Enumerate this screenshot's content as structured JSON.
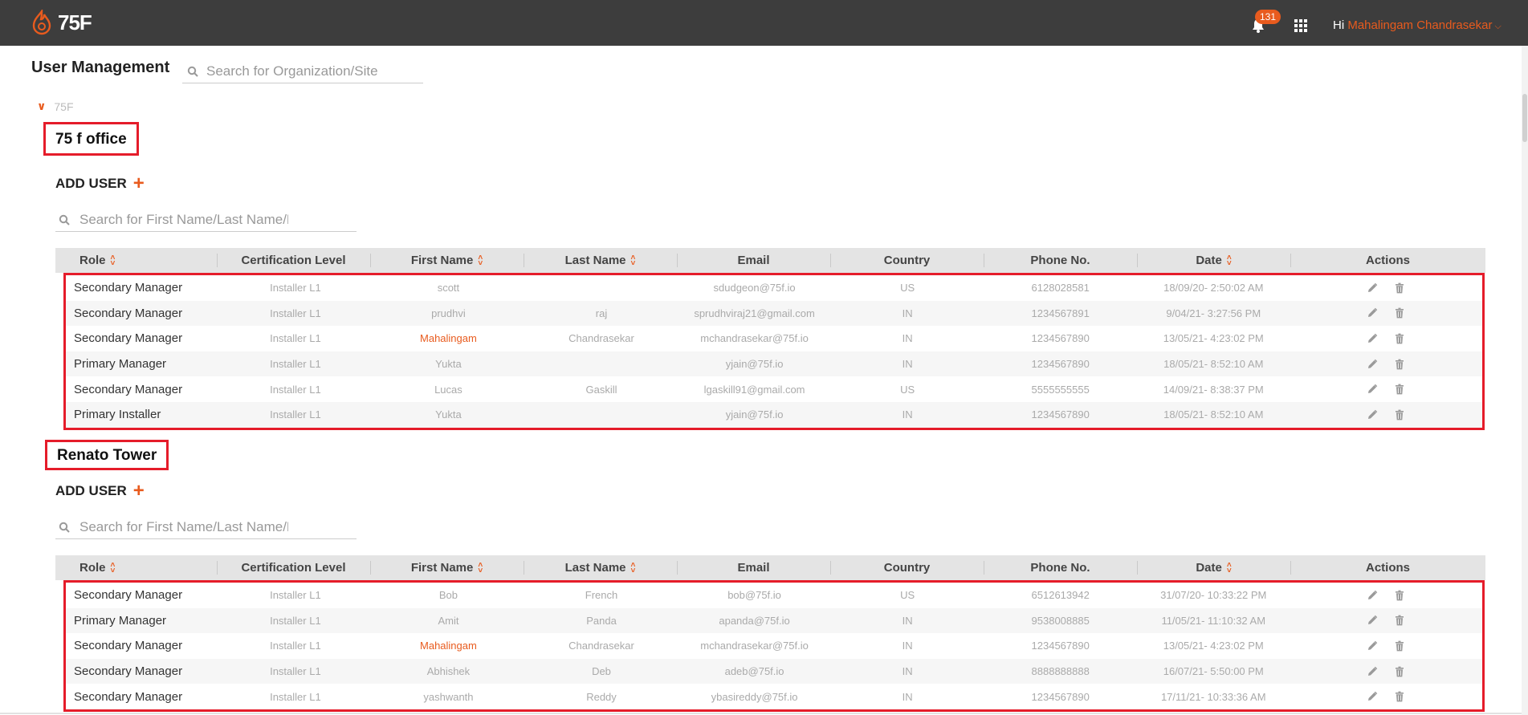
{
  "header": {
    "logo_text": "75F",
    "notification_count": "131",
    "greeting": "Hi",
    "user_name": "Mahalingam Chandrasekar",
    "accent": "#e85b1e"
  },
  "page": {
    "title": "User Management",
    "org_search_placeholder": "Search for Organization/Site",
    "tree_label": "75F"
  },
  "columns": [
    "Role",
    "Certification Level",
    "First Name",
    "Last Name",
    "Email",
    "Country",
    "Phone No.",
    "Date",
    "Actions"
  ],
  "sections": [
    {
      "site": "75 f office",
      "add_user": "ADD USER",
      "search_placeholder": "Search for First Name/Last Name/Email",
      "rows": [
        {
          "role": "Secondary Manager",
          "cert": "Installer L1",
          "first": "scott",
          "last": "",
          "email": "sdudgeon@75f.io",
          "country": "US",
          "phone": "6128028581",
          "date": "18/09/20- 2:50:02 AM"
        },
        {
          "role": "Secondary Manager",
          "cert": "Installer L1",
          "first": "prudhvi",
          "last": "raj",
          "email": "sprudhviraj21@gmail.com",
          "country": "IN",
          "phone": "1234567891",
          "date": "9/04/21- 3:27:56 PM"
        },
        {
          "role": "Secondary Manager",
          "cert": "Installer L1",
          "first": "Mahalingam",
          "last": "Chandrasekar",
          "email": "mchandrasekar@75f.io",
          "country": "IN",
          "phone": "1234567890",
          "date": "13/05/21- 4:23:02 PM"
        },
        {
          "role": "Primary Manager",
          "cert": "Installer L1",
          "first": "Yukta",
          "last": "",
          "email": "yjain@75f.io",
          "country": "IN",
          "phone": "1234567890",
          "date": "18/05/21- 8:52:10 AM"
        },
        {
          "role": "Secondary Manager",
          "cert": "Installer L1",
          "first": "Lucas",
          "last": "Gaskill",
          "email": "lgaskill91@gmail.com",
          "country": "US",
          "phone": "5555555555",
          "date": "14/09/21- 8:38:37 PM"
        },
        {
          "role": "Primary Installer",
          "cert": "Installer L1",
          "first": "Yukta",
          "last": "",
          "email": "yjain@75f.io",
          "country": "IN",
          "phone": "1234567890",
          "date": "18/05/21- 8:52:10 AM"
        }
      ]
    },
    {
      "site": "Renato Tower",
      "add_user": "ADD USER",
      "search_placeholder": "Search for First Name/Last Name/Email",
      "rows": [
        {
          "role": "Secondary Manager",
          "cert": "Installer L1",
          "first": "Bob",
          "last": "French",
          "email": "bob@75f.io",
          "country": "US",
          "phone": "6512613942",
          "date": "31/07/20- 10:33:22 PM"
        },
        {
          "role": "Primary Manager",
          "cert": "Installer L1",
          "first": "Amit",
          "last": "Panda",
          "email": "apanda@75f.io",
          "country": "IN",
          "phone": "9538008885",
          "date": "11/05/21- 11:10:32 AM"
        },
        {
          "role": "Secondary Manager",
          "cert": "Installer L1",
          "first": "Mahalingam",
          "last": "Chandrasekar",
          "email": "mchandrasekar@75f.io",
          "country": "IN",
          "phone": "1234567890",
          "date": "13/05/21- 4:23:02 PM"
        },
        {
          "role": "Secondary Manager",
          "cert": "Installer L1",
          "first": "Abhishek",
          "last": "Deb",
          "email": "adeb@75f.io",
          "country": "IN",
          "phone": "8888888888",
          "date": "16/07/21- 5:50:00 PM"
        },
        {
          "role": "Secondary Manager",
          "cert": "Installer L1",
          "first": "yashwanth",
          "last": "Reddy",
          "email": "ybasireddy@75f.io",
          "country": "IN",
          "phone": "1234567890",
          "date": "17/11/21- 10:33:36 AM"
        }
      ]
    }
  ]
}
